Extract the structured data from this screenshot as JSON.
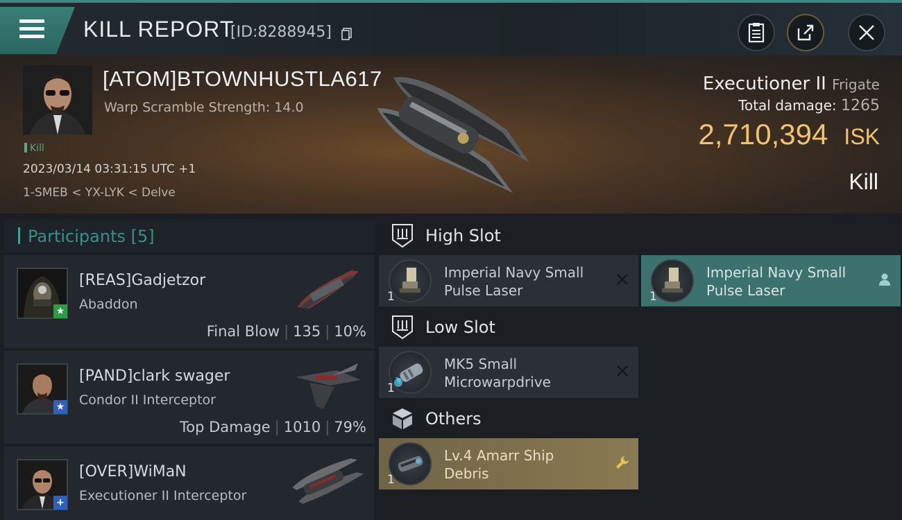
{
  "header": {
    "title": "KILL REPORT",
    "report_id": "[ID:8288945]"
  },
  "victim": {
    "name": "[ATOM]BTOWNHUSTLA617",
    "warp_scramble": "Warp Scramble Strength: 14.0",
    "tag": "Kill",
    "datetime": "2023/03/14 03:31:15 UTC +1",
    "location": "1-SMEB < YX-LYK < Delve",
    "ship": "Executioner II",
    "ship_class": "Frigate",
    "total_damage_label": "Total damage:",
    "total_damage": "1265",
    "isk_value": "2,710,394",
    "isk_unit": "ISK",
    "result": "Kill"
  },
  "participants": {
    "header": "Participants",
    "count": "[5]",
    "rows": [
      {
        "name": "[REAS]Gadjetzor",
        "ship": "Abaddon",
        "role": "Final Blow",
        "damage": "135",
        "percent": "10%",
        "badge": "★",
        "badge_color": "#2e9a45"
      },
      {
        "name": "[PAND]clark swager",
        "ship": "Condor II Interceptor",
        "role": "Top Damage",
        "damage": "1010",
        "percent": "79%",
        "badge": "★",
        "badge_color": "#2f5fbf"
      },
      {
        "name": "[OVER]WiMaN",
        "ship": "Executioner II Interceptor",
        "role": "",
        "damage": "",
        "percent": "",
        "badge": "+",
        "badge_color": "#2f5fbf"
      }
    ]
  },
  "slots": {
    "high": {
      "label": "High Slot",
      "modules": [
        {
          "name_line1": "Imperial Navy Small",
          "name_line2": "Pulse Laser",
          "qty": "1",
          "action_icon": "close-icon"
        },
        {
          "name_line1": "Imperial Navy Small",
          "name_line2": "Pulse Laser",
          "qty": "1",
          "action_icon": "person-icon"
        }
      ]
    },
    "low": {
      "label": "Low Slot",
      "modules": [
        {
          "name_line1": "MK5 Small",
          "name_line2": "Microwarpdrive",
          "qty": "1",
          "action_icon": "close-icon"
        }
      ]
    },
    "others": {
      "label": "Others",
      "modules": [
        {
          "name_line1": "Lv.4 Amarr Ship",
          "name_line2": "Debris",
          "qty": "1",
          "action_icon": "wrench-icon"
        }
      ]
    }
  }
}
